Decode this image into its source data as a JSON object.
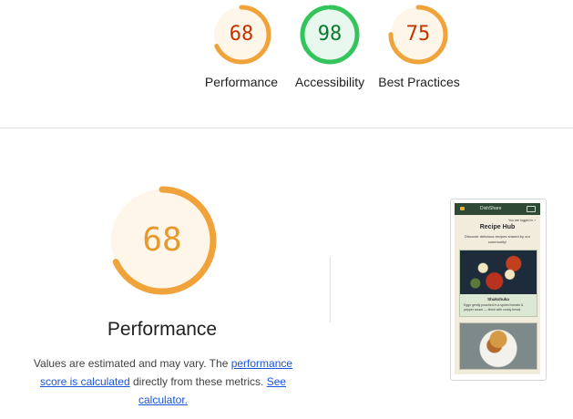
{
  "top_scores": [
    {
      "label": "Performance",
      "score": "68",
      "fraction": 0.68,
      "color": "#f0a33a",
      "text_color": "#c33300",
      "bg": "#fff6ea"
    },
    {
      "label": "Accessibility",
      "score": "98",
      "fraction": 0.98,
      "color": "#33c45c",
      "text_color": "#0a7a2e",
      "bg": "#e9f8ee"
    },
    {
      "label": "Best Practices",
      "score": "75",
      "fraction": 0.75,
      "color": "#f0a33a",
      "text_color": "#c33300",
      "bg": "#fff6ea"
    }
  ],
  "main": {
    "score": "68",
    "fraction": 0.68,
    "color": "#f0a33a",
    "text_color": "#e59a2e",
    "bg": "#fff6ea",
    "title": "Performance",
    "desc_prefix": "Values are estimated and may vary. The ",
    "link1": "performance score is calculated",
    "desc_middle": " directly from these metrics. ",
    "link2": "See calculator."
  },
  "preview": {
    "brand": "DishShare",
    "logged_in": "You are logged in ✓",
    "title": "Recipe Hub",
    "subtitle": "Discover delicious recipes shared by our community!",
    "card_title": "Shakshuka",
    "card_text": "Eggs gently poached in a spiced tomato & pepper sauce — finish with crusty bread."
  }
}
